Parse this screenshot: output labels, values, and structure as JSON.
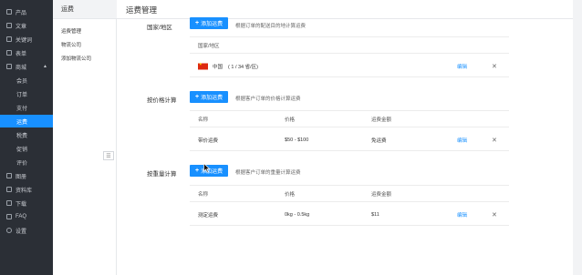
{
  "nav": {
    "items": [
      {
        "label": "产品",
        "icon": "product-icon"
      },
      {
        "label": "文章",
        "icon": "article-icon"
      },
      {
        "label": "关键词",
        "icon": "keyword-icon"
      },
      {
        "label": "表单",
        "icon": "form-icon"
      },
      {
        "label": "商城",
        "icon": "shop-icon",
        "expanded": true
      }
    ],
    "shop_sub": [
      {
        "label": "会员",
        "active": false
      },
      {
        "label": "订单",
        "active": false
      },
      {
        "label": "支付",
        "active": false
      },
      {
        "label": "运费",
        "active": true
      },
      {
        "label": "税费",
        "active": false
      },
      {
        "label": "促销",
        "active": false
      },
      {
        "label": "评价",
        "active": false
      }
    ],
    "bottom_items": [
      {
        "label": "图册",
        "icon": "gallery-icon"
      },
      {
        "label": "资料库",
        "icon": "library-icon"
      },
      {
        "label": "下载",
        "icon": "download-icon"
      },
      {
        "label": "FAQ",
        "icon": "faq-icon"
      },
      {
        "label": "设置",
        "icon": "settings-icon"
      }
    ]
  },
  "subnav": {
    "title": "运费",
    "items": [
      "运费管理",
      "物流公司",
      "添加物流公司"
    ]
  },
  "page": {
    "title": "运费管理"
  },
  "sections": {
    "region": {
      "label": "国家/地区",
      "button": "添加运费",
      "hint": "根据订单的配送目的地计算运费",
      "table_header": "国家/地区",
      "row": {
        "name": "中国",
        "count": "( 1 / 34 省/区)",
        "edit": "编辑",
        "remove": "✕"
      }
    },
    "price": {
      "label": "按价格计算",
      "button": "添加运费",
      "hint": "根据客户订单的价格计算运费",
      "headers": [
        "名称",
        "价格",
        "运费金额"
      ],
      "row": {
        "name": "带价运费",
        "range": "$50 - $100",
        "fee": "免运费",
        "edit": "编辑",
        "remove": "✕"
      }
    },
    "weight": {
      "label": "按重量计算",
      "button": "添加运费",
      "hint": "根据客户订单的重量计算运费",
      "headers": [
        "名称",
        "价格",
        "运费金额"
      ],
      "row": {
        "name": "测定运费",
        "range": "0kg - 0.5kg",
        "fee": "$11",
        "edit": "编辑",
        "remove": "✕"
      }
    }
  },
  "colors": {
    "accent": "#1890ff",
    "nav_bg": "#2b2f36"
  }
}
